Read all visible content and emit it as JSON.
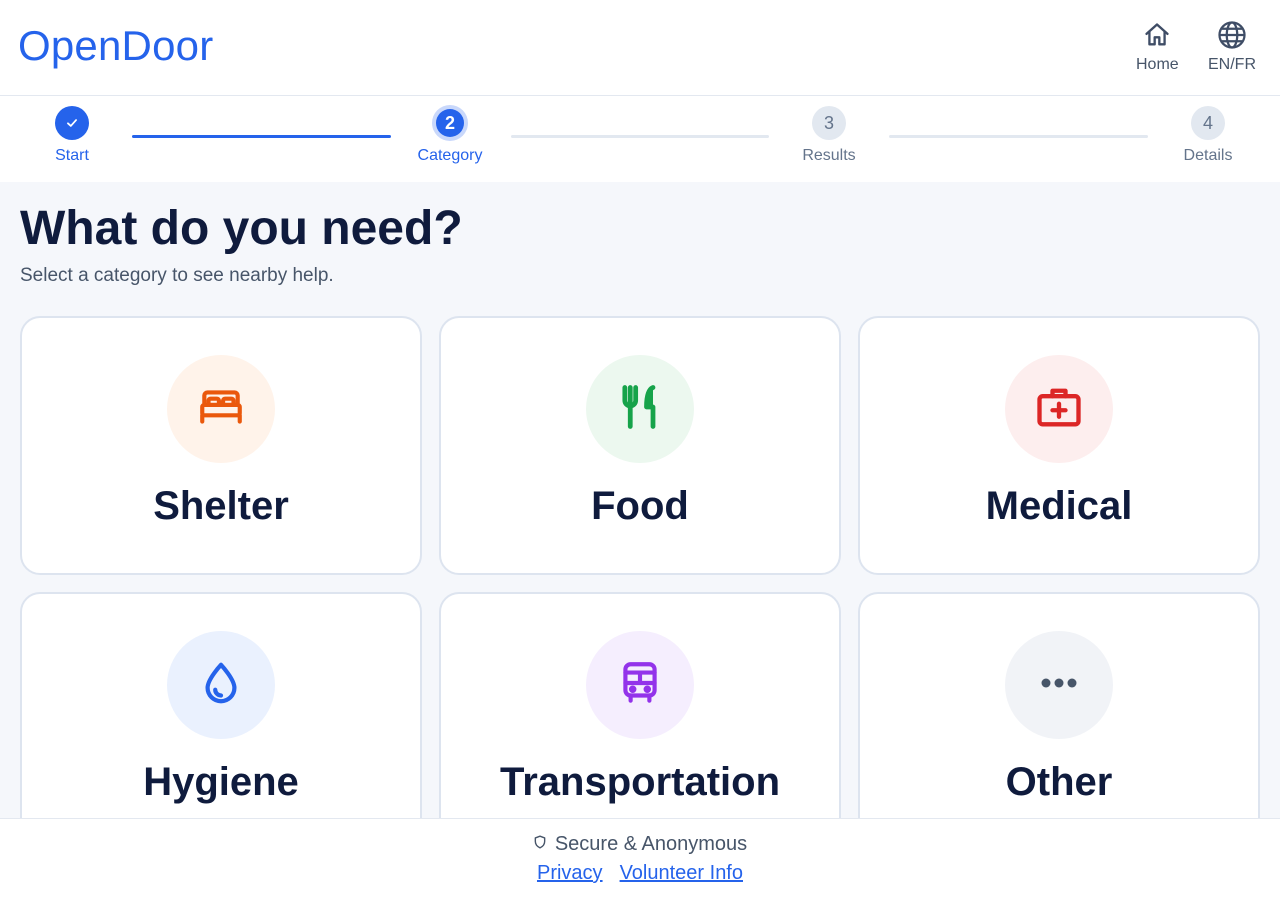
{
  "app": {
    "brand": "OpenDoor"
  },
  "header": {
    "home_label": "Home",
    "lang_label": "EN/FR"
  },
  "stepper": {
    "current_step": 2,
    "steps": [
      {
        "number": "1",
        "label": "Start",
        "state": "done"
      },
      {
        "number": "2",
        "label": "Category",
        "state": "active"
      },
      {
        "number": "3",
        "label": "Results",
        "state": "todo"
      },
      {
        "number": "4",
        "label": "Details",
        "state": "todo"
      }
    ]
  },
  "main": {
    "title": "What do you need?",
    "subtitle": "Select a category to see nearby help."
  },
  "categories": [
    {
      "label": "Shelter",
      "icon": "bed-icon",
      "color": "#ea580c",
      "bg": "#fff3ea"
    },
    {
      "label": "Food",
      "icon": "utensils-icon",
      "color": "#16a34a",
      "bg": "#ecf8ef"
    },
    {
      "label": "Medical",
      "icon": "first-aid-icon",
      "color": "#dc2626",
      "bg": "#fdeeee"
    },
    {
      "label": "Hygiene",
      "icon": "water-drop-icon",
      "color": "#2563eb",
      "bg": "#eaf1fe"
    },
    {
      "label": "Transportation",
      "icon": "bus-icon",
      "color": "#9333ea",
      "bg": "#f5eefe"
    },
    {
      "label": "Other",
      "icon": "more-dots-icon",
      "color": "#475569",
      "bg": "#f1f3f7"
    }
  ],
  "footer": {
    "secure_text": "Secure & Anonymous",
    "privacy_link": "Privacy",
    "volunteer_link": "Volunteer Info"
  },
  "colors": {
    "accent": "#2563eb",
    "text": "#0f1b3d",
    "muted": "#475569",
    "background": "#f5f7fb"
  }
}
